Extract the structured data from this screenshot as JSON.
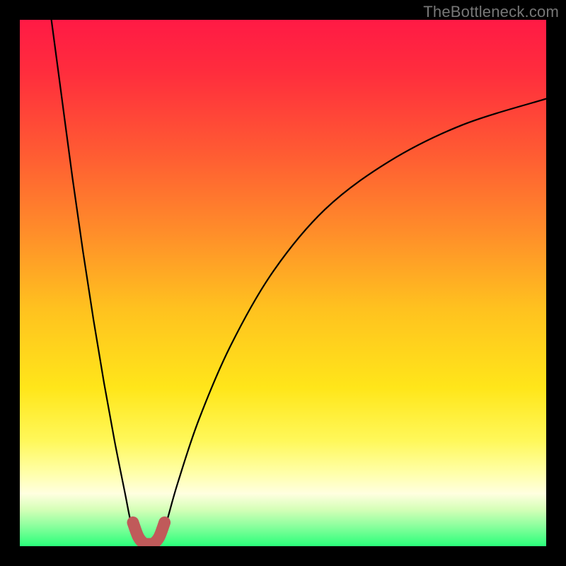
{
  "watermark": "TheBottleneck.com",
  "colors": {
    "black": "#000000",
    "curve": "#000000",
    "highlight": "#c05a5a",
    "gradient_stops": [
      {
        "offset": 0.0,
        "color": "#ff1a45"
      },
      {
        "offset": 0.1,
        "color": "#ff2d3d"
      },
      {
        "offset": 0.25,
        "color": "#ff5a33"
      },
      {
        "offset": 0.4,
        "color": "#ff8c2a"
      },
      {
        "offset": 0.55,
        "color": "#ffc21f"
      },
      {
        "offset": 0.7,
        "color": "#ffe61a"
      },
      {
        "offset": 0.8,
        "color": "#fff85a"
      },
      {
        "offset": 0.86,
        "color": "#ffffa8"
      },
      {
        "offset": 0.9,
        "color": "#ffffe0"
      },
      {
        "offset": 0.93,
        "color": "#d6ffb8"
      },
      {
        "offset": 0.96,
        "color": "#8fff9f"
      },
      {
        "offset": 1.0,
        "color": "#2aff7a"
      }
    ]
  },
  "chart_data": {
    "type": "line",
    "title": "",
    "xlabel": "",
    "ylabel": "",
    "xlim": [
      0,
      100
    ],
    "ylim": [
      0,
      100
    ],
    "grid": false,
    "series": [
      {
        "name": "left-branch",
        "x": [
          6,
          8,
          10,
          12,
          14,
          16,
          18,
          20,
          21,
          22,
          23
        ],
        "y": [
          100,
          85,
          70,
          56,
          43,
          31,
          20,
          10,
          5,
          2,
          0
        ]
      },
      {
        "name": "right-branch",
        "x": [
          26,
          27,
          28,
          30,
          34,
          40,
          48,
          58,
          70,
          84,
          100
        ],
        "y": [
          0,
          2,
          5,
          12,
          24,
          38,
          52,
          64,
          73,
          80,
          85
        ]
      }
    ],
    "highlight": {
      "name": "valley-highlight",
      "x": [
        21.5,
        22.5,
        23.5,
        24.5,
        25.5,
        26.5,
        27.5
      ],
      "y": [
        4.5,
        1.8,
        0.6,
        0.4,
        0.6,
        1.8,
        4.5
      ]
    },
    "valley_x": 24.5
  }
}
